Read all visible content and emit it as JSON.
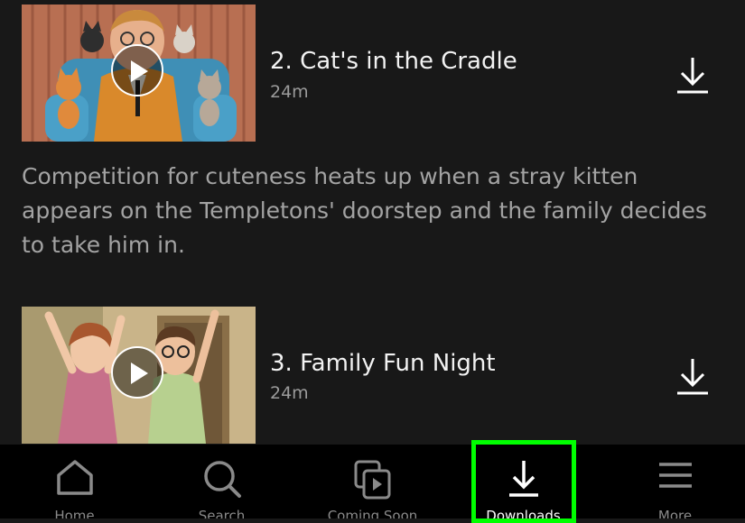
{
  "episodes": [
    {
      "title": "2. Cat's in the Cradle",
      "duration": "24m",
      "description": "Competition for cuteness heats up when a stray kitten appears on the Templetons' doorstep and the family decides to take him in."
    },
    {
      "title": "3. Family Fun Night",
      "duration": "24m"
    }
  ],
  "tabs": [
    {
      "label": "Home",
      "icon": "home-icon"
    },
    {
      "label": "Search",
      "icon": "search-icon"
    },
    {
      "label": "Coming Soon",
      "icon": "coming-soon-icon"
    },
    {
      "label": "Downloads",
      "icon": "download-icon",
      "active": true
    },
    {
      "label": "More",
      "icon": "menu-icon"
    }
  ],
  "colors": {
    "background": "#181818",
    "tabbar": "#000000",
    "highlight": "#00ff00",
    "secondary_text": "#a3a3a3"
  }
}
